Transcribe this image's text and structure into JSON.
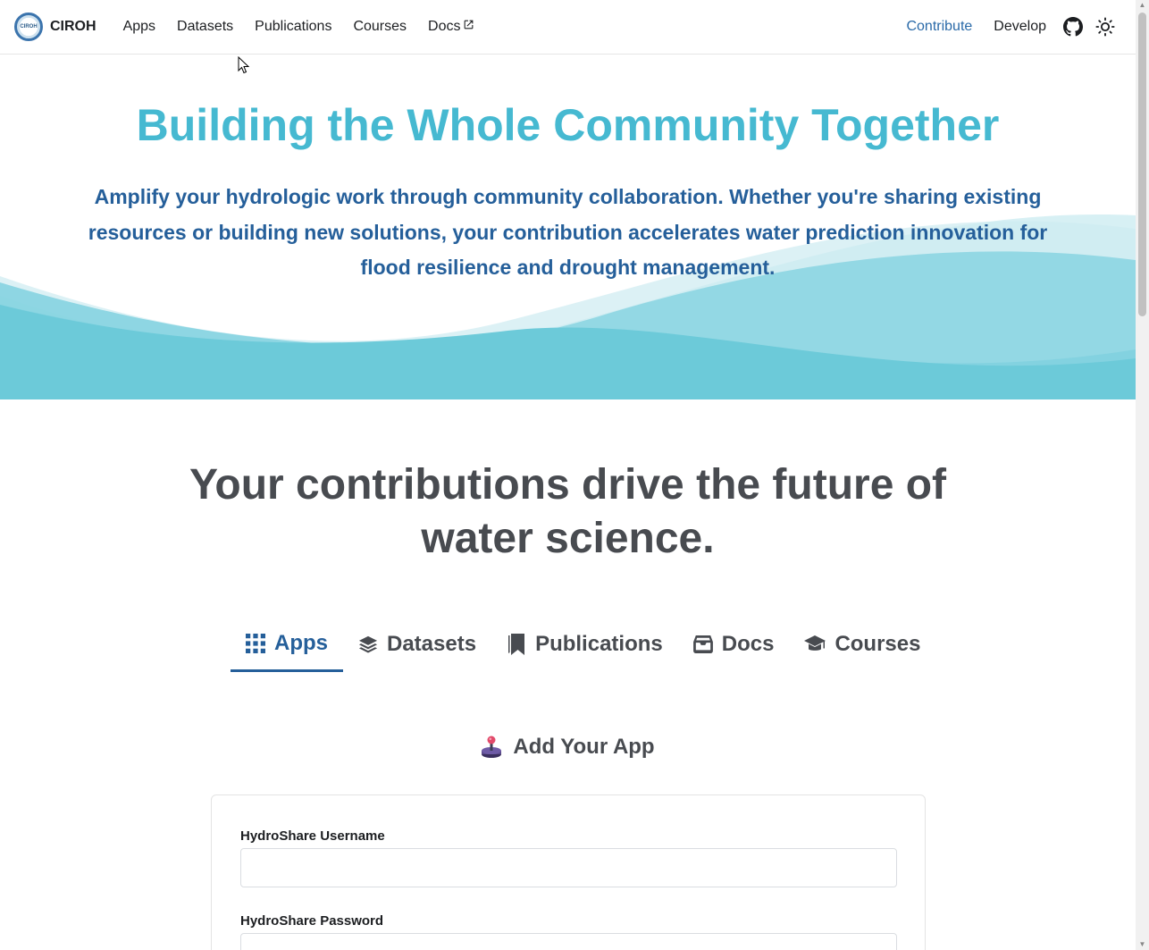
{
  "nav": {
    "logo_text": "CIROH",
    "brand": "CIROH",
    "links": [
      "Apps",
      "Datasets",
      "Publications",
      "Courses",
      "Docs"
    ],
    "right_links": [
      "Contribute",
      "Develop"
    ],
    "icons": [
      "external-link-icon",
      "github-icon",
      "sun-icon"
    ]
  },
  "hero": {
    "title": "Building the Whole Community Together",
    "subtitle": "Amplify your hydrologic work through community collaboration. Whether you're sharing existing resources or building new solutions, your contribution accelerates water prediction innovation for flood resilience and drought management."
  },
  "headline": {
    "line1": "Your contributions drive the future of",
    "line2": "water science."
  },
  "tabs": [
    {
      "label": "Apps",
      "icon": "grid-icon",
      "active": true
    },
    {
      "label": "Datasets",
      "icon": "layers-icon",
      "active": false
    },
    {
      "label": "Publications",
      "icon": "bookmark-icon",
      "active": false
    },
    {
      "label": "Docs",
      "icon": "inbox-icon",
      "active": false
    },
    {
      "label": "Courses",
      "icon": "graduation-cap-icon",
      "active": false
    }
  ],
  "section": {
    "title": "Add Your App",
    "icon": "joystick-icon"
  },
  "form": {
    "username_label": "HydroShare Username",
    "username_value": "",
    "password_label": "HydroShare Password",
    "password_value": ""
  },
  "colors": {
    "hero_title": "#46b9d1",
    "hero_text": "#255f9a",
    "accent": "#255f9a",
    "wave_light": "#d7f0f4",
    "wave_mid": "#93d8e4",
    "wave_dark": "#6ccad9"
  }
}
